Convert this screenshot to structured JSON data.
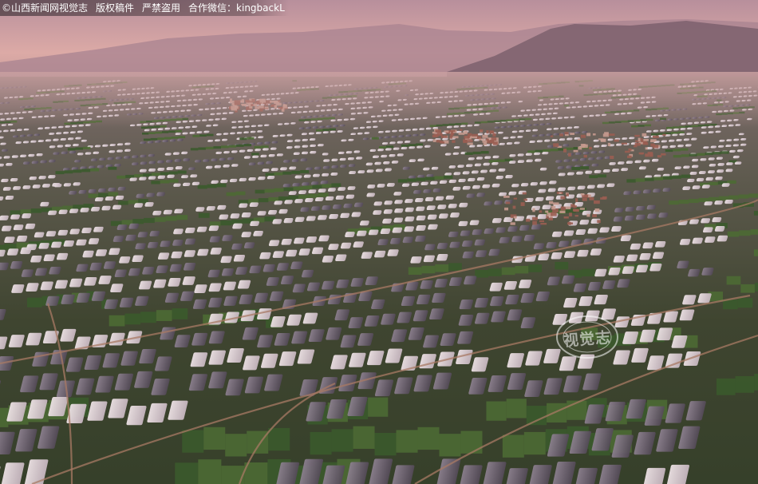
{
  "credit": {
    "source": "©山西新闻网视觉志",
    "rights": "版权稿件",
    "warning": "严禁盗用",
    "contact": "合作微信：kingbackL"
  },
  "watermark": {
    "text": "视觉志"
  },
  "colors": {
    "sky_top": "#b98f9c",
    "sky_horizon": "#e6b2a6",
    "mountains": "#8a6f7a",
    "field_green": "#3e4d2c",
    "greenhouse_light": "#e8dde4",
    "greenhouse_dark": "#6d6170",
    "soil": "#9b6650"
  }
}
